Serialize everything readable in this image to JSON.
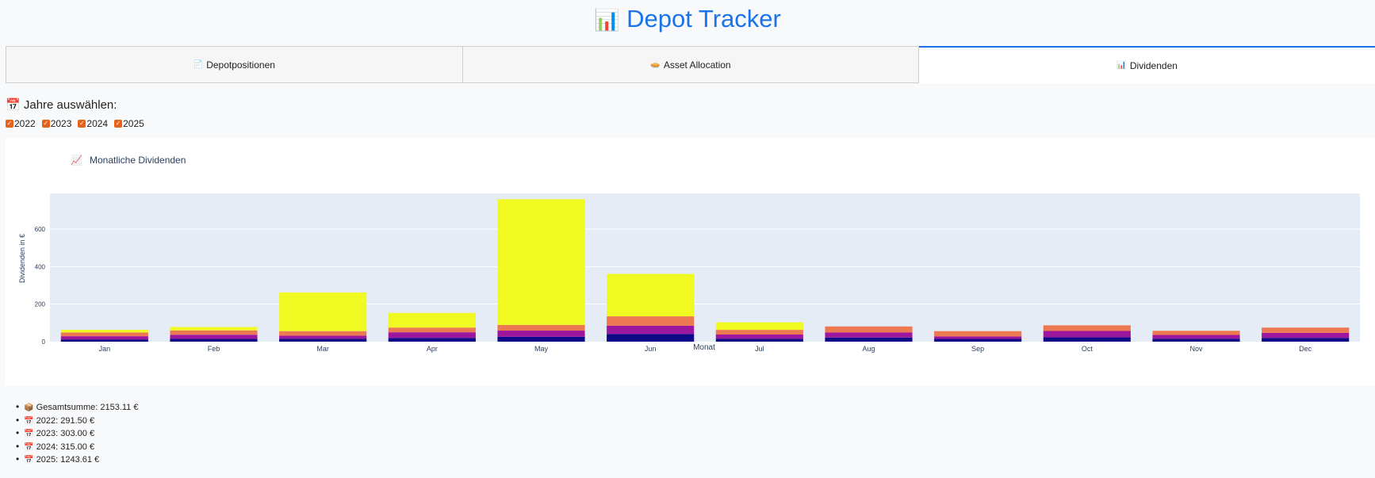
{
  "app": {
    "title": "Depot Tracker",
    "title_icon": "📊"
  },
  "tabs": [
    {
      "label": "Depotpositionen",
      "icon": "📄",
      "active": false
    },
    {
      "label": "Asset Allocation",
      "icon": "🥧",
      "active": false
    },
    {
      "label": "Dividenden",
      "icon": "📊",
      "active": true
    }
  ],
  "year_selector": {
    "heading": "Jahre auswählen:",
    "heading_icon": "📅",
    "options": [
      {
        "label": "2022",
        "checked": true
      },
      {
        "label": "2023",
        "checked": true
      },
      {
        "label": "2024",
        "checked": true
      },
      {
        "label": "2025",
        "checked": true
      }
    ]
  },
  "chart_data": {
    "type": "bar",
    "stacked": true,
    "title": "Monatliche Dividenden",
    "title_icon": "📈",
    "xlabel": "Monat",
    "ylabel": "Dividenden in €",
    "ylim": [
      0,
      790
    ],
    "yticks": [
      0,
      200,
      400,
      600
    ],
    "grid": true,
    "legend": "none",
    "categories": [
      "Jan",
      "Feb",
      "Mar",
      "Apr",
      "May",
      "Jun",
      "Jul",
      "Aug",
      "Sep",
      "Oct",
      "Nov",
      "Dec"
    ],
    "series": [
      {
        "color": "#0d0887",
        "values": [
          12,
          15,
          16,
          20,
          26,
          41,
          16,
          22,
          15,
          23,
          16,
          20
        ]
      },
      {
        "color": "#9c179e",
        "values": [
          17,
          22,
          16,
          30,
          33,
          44,
          22,
          27,
          13,
          34,
          20,
          27
        ]
      },
      {
        "color": "#ed7953",
        "values": [
          20,
          23,
          24,
          25,
          30,
          50,
          25,
          32,
          28,
          30,
          22,
          28
        ]
      },
      {
        "color": "#f0f921",
        "values": [
          14,
          18,
          206,
          78,
          670,
          226,
          40,
          0,
          0,
          0,
          0,
          0
        ]
      }
    ]
  },
  "summary": [
    {
      "icon": "📦",
      "text": "Gesamtsumme: 2153.11 €"
    },
    {
      "icon": "📅",
      "text": "2022: 291.50 €"
    },
    {
      "icon": "📅",
      "text": "2023: 303.00 €"
    },
    {
      "icon": "📅",
      "text": "2024: 315.00 €"
    },
    {
      "icon": "📅",
      "text": "2025: 1243.61 €"
    }
  ]
}
